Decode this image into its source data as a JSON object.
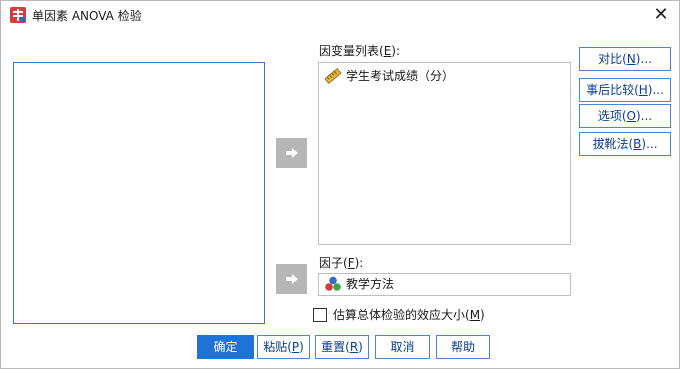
{
  "window": {
    "title": "单因素 ANOVA 检验",
    "close_glyph": "✕"
  },
  "dependent_list": {
    "label_prefix": "因变量列表(",
    "label_mnemonic": "E",
    "label_suffix": "):",
    "items": [
      {
        "label": "学生考试成绩（分）",
        "icon": "ruler-scale-icon"
      }
    ]
  },
  "factor": {
    "label_prefix": "因子(",
    "label_mnemonic": "F",
    "label_suffix": "):",
    "value": "教学方法",
    "icon": "nominal-balls-icon"
  },
  "side_buttons": [
    {
      "prefix": "对比(",
      "mnemonic": "N",
      "suffix": ")..."
    },
    {
      "prefix": "事后比较(",
      "mnemonic": "H",
      "suffix": ")..."
    },
    {
      "prefix": "选项(",
      "mnemonic": "O",
      "suffix": ")..."
    },
    {
      "prefix": "拔靴法(",
      "mnemonic": "B",
      "suffix": ")..."
    }
  ],
  "effect_size": {
    "checked": false,
    "prefix": "估算总体检验的效应大小(",
    "mnemonic": "M",
    "suffix": ")"
  },
  "bottom_buttons": {
    "ok": "确定",
    "paste_prefix": "粘贴(",
    "paste_mnemonic": "P",
    "paste_suffix": ")",
    "reset_prefix": "重置(",
    "reset_mnemonic": "R",
    "reset_suffix": ")",
    "cancel": "取消",
    "help": "帮助"
  },
  "colors": {
    "accent": "#1f72d6",
    "focus_border": "#3a72c9",
    "arrow_button_bg": "#b6b6b6"
  }
}
